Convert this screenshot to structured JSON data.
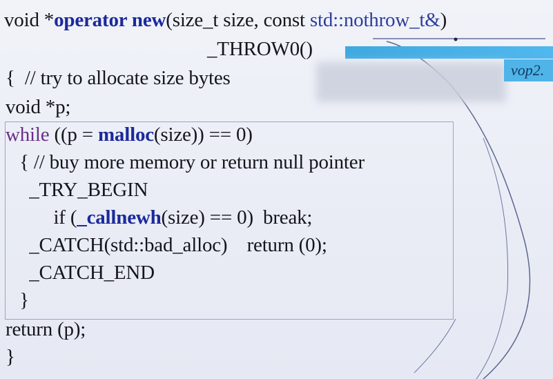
{
  "code": {
    "line1": {
      "prefix": "void *",
      "func": "operator new",
      "params": "(size_t size, const ",
      "nothrow": "std::nothrow_t&",
      "close": ")"
    },
    "line2": "_THROW0()",
    "line3": "{  // try to allocate size bytes",
    "line4": "void *p;",
    "line5": {
      "kw": "while",
      "a": " ((p = ",
      "fn": "malloc",
      "b": "(size)) == 0)"
    },
    "line6": "  { // buy more memory or return null pointer",
    "line7": "    _TRY_BEGIN",
    "line8": {
      "a": "         if (",
      "fn": "_callnewh",
      "b": "(size) == 0)  break;"
    },
    "line9": "    _CATCH(std::bad_alloc)    return (0);",
    "line10": "    _CATCH_END",
    "line11": "  }",
    "line12": "return (p);",
    "line13": "}"
  },
  "overlay": {
    "tag": "vop2."
  },
  "colors": {
    "background": "#eef0f7",
    "keyword_blue": "#1b2a9a",
    "keyword_purple": "#6a2f87",
    "overlay_blue": "#4fb4e8"
  }
}
